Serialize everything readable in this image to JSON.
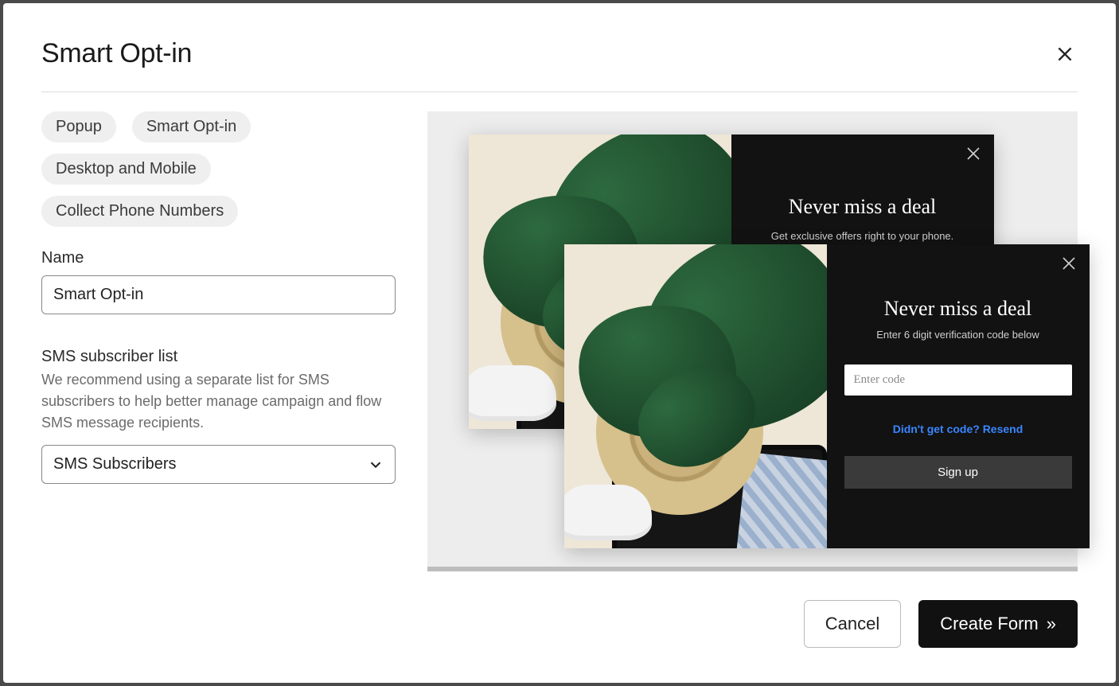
{
  "modal": {
    "title": "Smart Opt-in",
    "pills": {
      "popup": "Popup",
      "smart_optin": "Smart Opt-in",
      "platform": "Desktop and Mobile",
      "collect": "Collect Phone Numbers"
    },
    "name_field": {
      "label": "Name",
      "value": "Smart Opt-in"
    },
    "sms_section": {
      "heading": "SMS subscriber list",
      "help": "We recommend using a separate list for SMS subscribers to help better manage campaign and flow SMS message recipients.",
      "selected": "SMS Subscribers"
    },
    "footer": {
      "cancel": "Cancel",
      "create": "Create Form"
    }
  },
  "preview": {
    "back": {
      "heading": "Never miss a deal",
      "sub": "Get exclusive offers right to your phone."
    },
    "front": {
      "heading": "Never miss a deal",
      "sub": "Enter 6 digit verification code below",
      "code_placeholder": "Enter code",
      "resend": "Didn't get code? Resend",
      "signup": "Sign up"
    }
  }
}
